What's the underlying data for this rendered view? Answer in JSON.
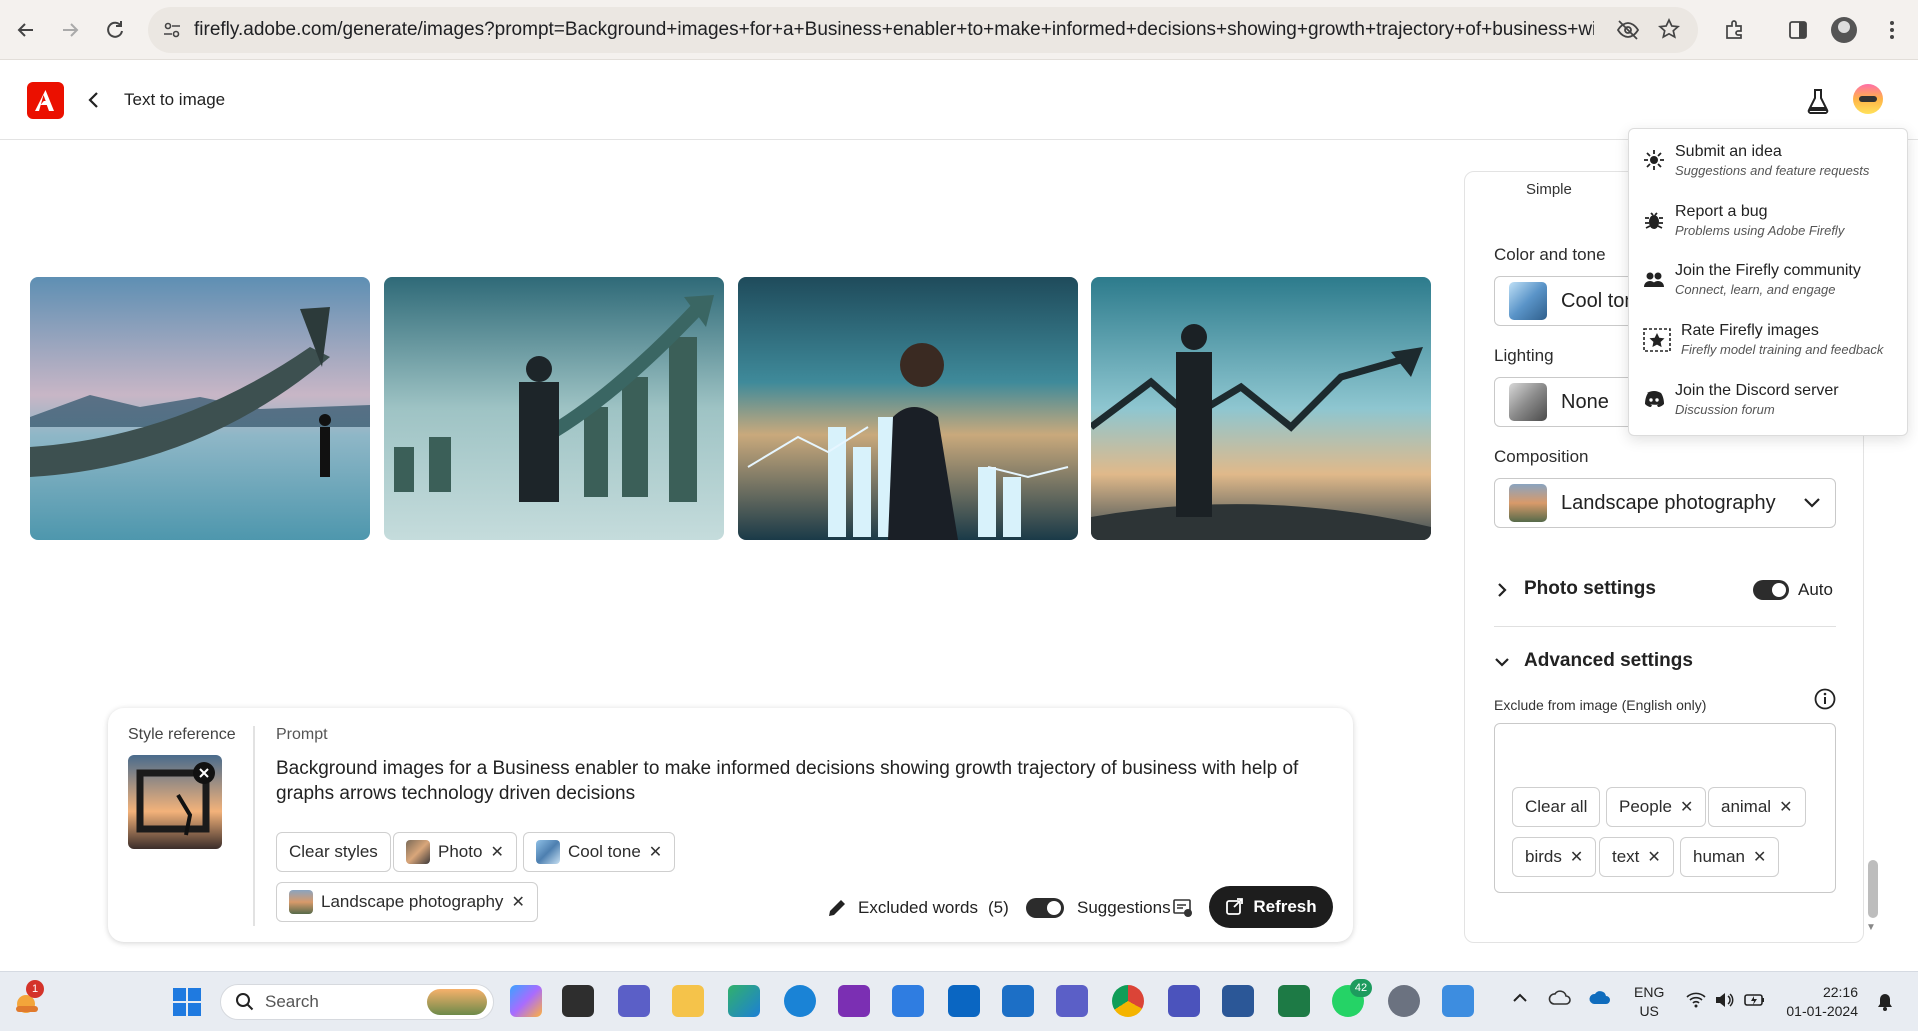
{
  "browser": {
    "url": "firefly.adobe.com/generate/images?prompt=Background+images+for+a+Business+enabler+to+make+informed+decisions+showing+growth+trajectory+of+business+with+help+o..."
  },
  "header": {
    "back_label": "Text to image"
  },
  "prompt_card": {
    "style_reference_label": "Style reference",
    "prompt_label": "Prompt",
    "prompt_text": "Background images for a Business enabler to make informed decisions showing growth trajectory of business with help of graphs arrows technology driven decisions",
    "chips": [
      {
        "label": "Clear styles"
      },
      {
        "label": "Photo"
      },
      {
        "label": "Cool tone"
      },
      {
        "label": "Landscape photography"
      }
    ],
    "excluded_words_label": "Excluded words",
    "excluded_words_count": "(5)",
    "suggestions_label": "Suggestions",
    "refresh_label": "Refresh"
  },
  "panel": {
    "tab_simple": "Simple",
    "color_tone_label": "Color and tone",
    "color_tone_value": "Cool ton",
    "lighting_label": "Lighting",
    "lighting_value": "None",
    "composition_label": "Composition",
    "composition_value": "Landscape photography",
    "photo_settings_label": "Photo settings",
    "photo_settings_toggle": "Auto",
    "advanced_label": "Advanced settings",
    "exclude_label": "Exclude from image (English only)",
    "exclude_chips": [
      {
        "label": "Clear all"
      },
      {
        "label": "People"
      },
      {
        "label": "animal"
      },
      {
        "label": "birds"
      },
      {
        "label": "text"
      },
      {
        "label": "human"
      }
    ]
  },
  "help_menu": [
    {
      "title": "Submit an idea",
      "sub": "Suggestions and feature requests"
    },
    {
      "title": "Report a bug",
      "sub": "Problems using Adobe Firefly"
    },
    {
      "title": "Join the Firefly community",
      "sub": "Connect, learn, and engage"
    },
    {
      "title": "Rate Firefly images",
      "sub": "Firefly model training and feedback"
    },
    {
      "title": "Join the Discord server",
      "sub": "Discussion forum"
    }
  ],
  "taskbar": {
    "search_placeholder": "Search",
    "notification_badge": "1",
    "whatsapp_badge": "42",
    "lang_line1": "ENG",
    "lang_line2": "US",
    "time": "22:16",
    "date": "01-01-2024"
  },
  "colors": {
    "adobe_red": "#eb1000",
    "refresh_bg": "#1d1d1d",
    "toggle_on": "#2c2c2c"
  }
}
